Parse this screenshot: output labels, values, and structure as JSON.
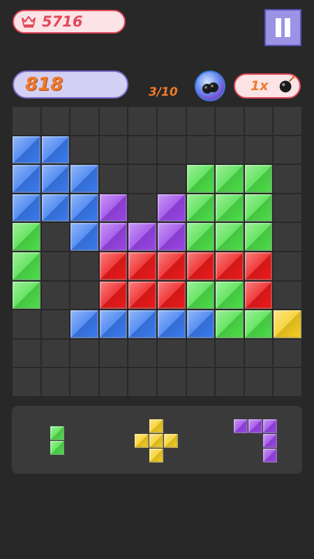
{
  "header": {
    "best_score": "5716",
    "current_score": "818",
    "progress": "3/10",
    "bomb_count": "1x"
  },
  "colors": {
    "blue": "#3b7cf0",
    "green": "#4ee04a",
    "purple": "#9a46e8",
    "red": "#ee1b1b",
    "yellow": "#f7cf22",
    "empty": "#3a3a3a"
  },
  "icons": {
    "best": "crown-icon",
    "pause": "pause-icon",
    "bomb_powerup": "bombs-icon",
    "bomb": "bomb-icon"
  },
  "board": {
    "rows": [
      "..........",
      "BB........",
      "BBB...GGG.",
      "BBBP.PGGG.",
      "G.BPPPGGG.",
      "G..RRRRRR.",
      "G..RRRGGR.",
      "..BBBBBGGY",
      "..........",
      ".........."
    ]
  },
  "tray": {
    "pieces": [
      {
        "color": "green",
        "cells": [
          [
            0,
            0
          ],
          [
            1,
            0
          ]
        ]
      },
      {
        "color": "yellow",
        "cells": [
          [
            0,
            1
          ],
          [
            1,
            0
          ],
          [
            1,
            1
          ],
          [
            1,
            2
          ],
          [
            2,
            1
          ]
        ]
      },
      {
        "color": "purple",
        "cells": [
          [
            0,
            0
          ],
          [
            0,
            1
          ],
          [
            0,
            2
          ],
          [
            1,
            2
          ],
          [
            2,
            2
          ]
        ]
      }
    ]
  }
}
